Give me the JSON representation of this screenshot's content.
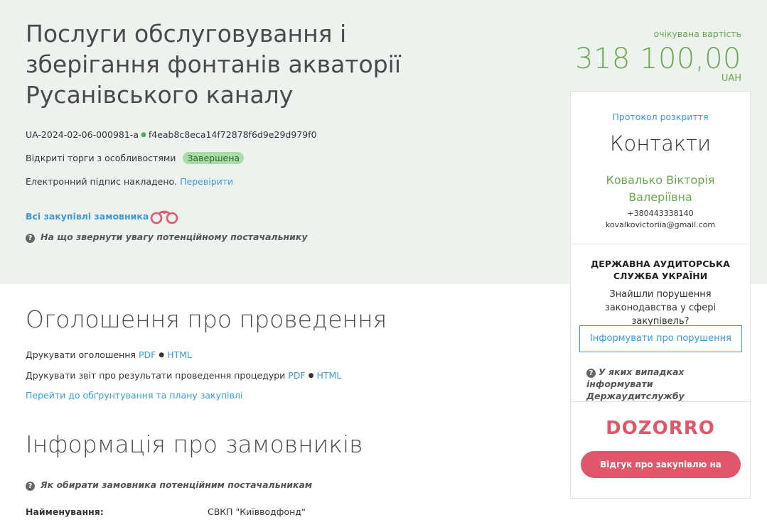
{
  "header": {
    "title": "Послуги обслуговування і зберігання фонтанів акваторії Русанівського каналу",
    "tender_id": "UA-2024-02-06-000981-a",
    "hash": "f4eab8c8eca14f72878f6d9e29d979f0",
    "procedure_type": "Відкриті торги з особливостями",
    "status": "Завершена",
    "signature_text": "Електронний підпис накладено.",
    "verify_link": "Перевірити",
    "all_purchases_link": "Всі закупівлі замовника",
    "supplier_hint": "На що звернути увагу потенційному постачальнику"
  },
  "price": {
    "label": "очікувана вартість",
    "value": "318 100,00",
    "currency": "UAH"
  },
  "announcement": {
    "title": "Оголошення про проведення",
    "print_notice_label": "Друкувати оголошення",
    "print_report_label": "Друкувати звіт про результати проведення процедури",
    "pdf": "PDF",
    "html": "HTML",
    "plan_link": "Перейти до обґрунтування та плану закупівлі"
  },
  "customers": {
    "title": "Інформація про замовників",
    "hint": "Як обирати замовника потенційним постачальникам",
    "name_label": "Найменування:",
    "name_value": "СВКП \"Київводфонд\""
  },
  "sidebar": {
    "protocol_link": "Протокол розкриття",
    "contacts_title": "Контакти",
    "contact_name_line1": "Ковалько Вікторія",
    "contact_name_line2": "Валеріївна",
    "phone": "+380443338140",
    "email": "kovalkovictoriia@gmail.com",
    "audit_title": "ДЕРЖАВНА АУДИТОРСЬКА СЛУЖБА УКРАЇНИ",
    "audit_question": "Знайшли порушення законодавства у сфері закупівель?",
    "audit_button": "Інформувати про порушення",
    "audit_hint": "У яких випадках інформувати Держаудитслужбу",
    "dozorro_logo": "DOZORRO",
    "dozorro_button": "Відгук про закупівлю на Дозорро"
  },
  "colors": {
    "accent_green": "#6aa84f",
    "link_blue": "#3a9ad9",
    "dozorro_red": "#e0566a",
    "top_band": "#eef2ef"
  }
}
